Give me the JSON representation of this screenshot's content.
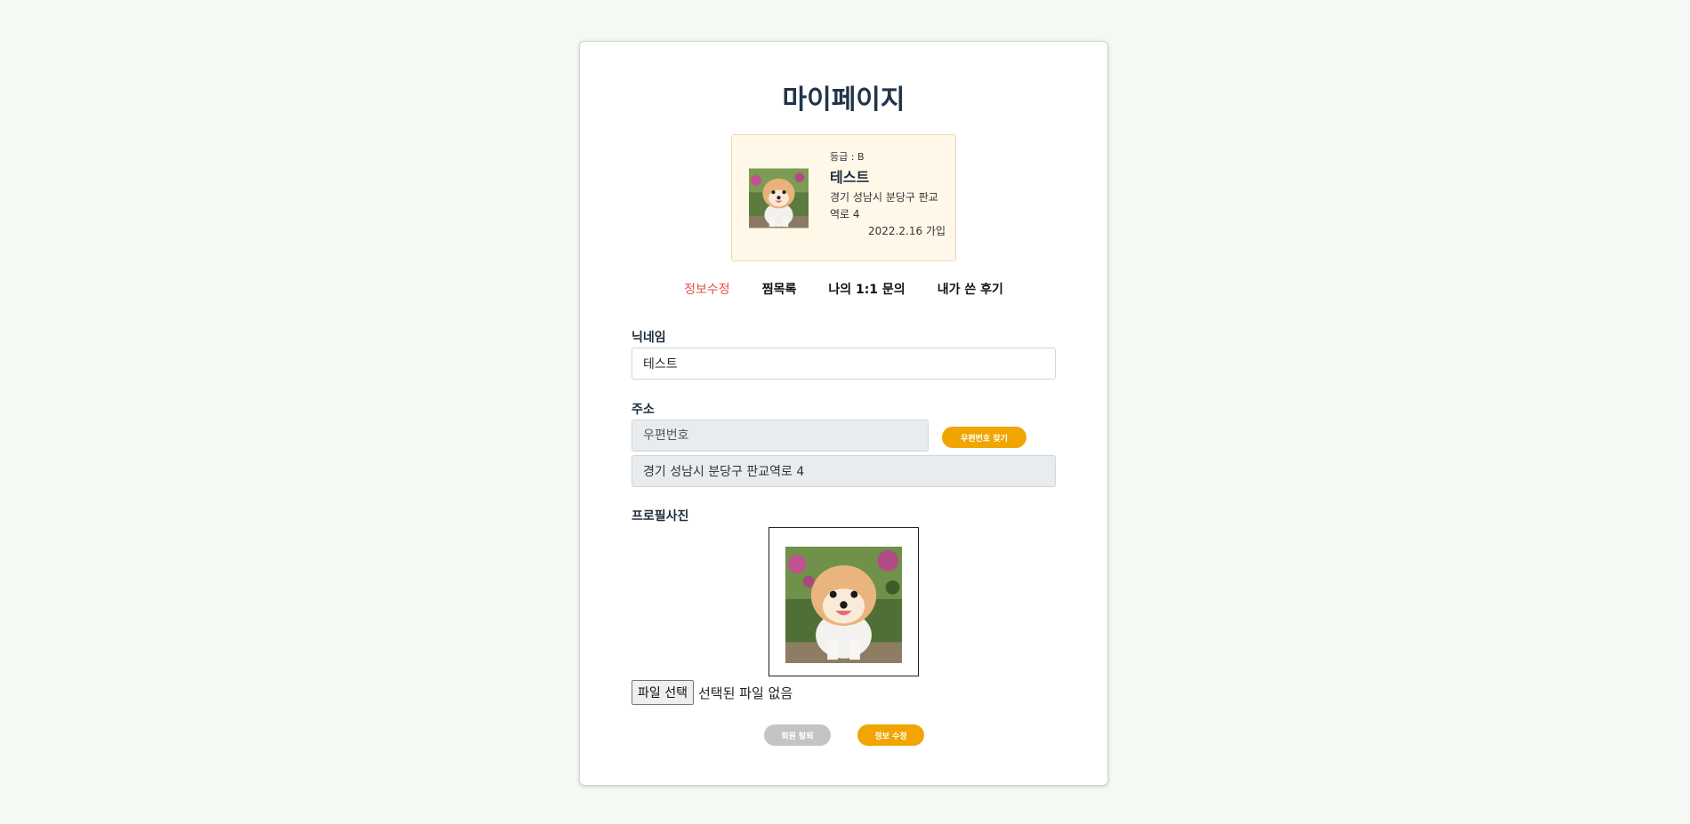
{
  "page": {
    "title": "마이페이지"
  },
  "profile": {
    "grade": "등급 : B",
    "name": "테스트",
    "address": "경기 성남시 분당구 판교역로 4",
    "joined": "2022.2.16 가입",
    "photo_icon": "pomeranian-dog-photo"
  },
  "tabs": [
    {
      "label": "정보수정",
      "active": true
    },
    {
      "label": "찜목록",
      "active": false
    },
    {
      "label": "나의 1:1 문의",
      "active": false
    },
    {
      "label": "내가 쓴 후기",
      "active": false
    }
  ],
  "form": {
    "nickname_label": "닉네임",
    "nickname_value": "테스트",
    "address_label": "주소",
    "zipcode_placeholder": "우편번호",
    "zipcode_button": "우편번호 찾기",
    "address_value": "경기 성남시 분당구 판교역로 4",
    "photo_label": "프로필사진",
    "file_button": "파일 선택",
    "file_status": "선택된 파일 없음"
  },
  "actions": {
    "withdraw_label": "회원 탈퇴",
    "update_label": "정보 수정"
  },
  "colors": {
    "accent": "#f0a500",
    "active_tab": "#e5534b",
    "profile_card_bg": "#fff8e9",
    "page_bg": "#f4faf3"
  }
}
